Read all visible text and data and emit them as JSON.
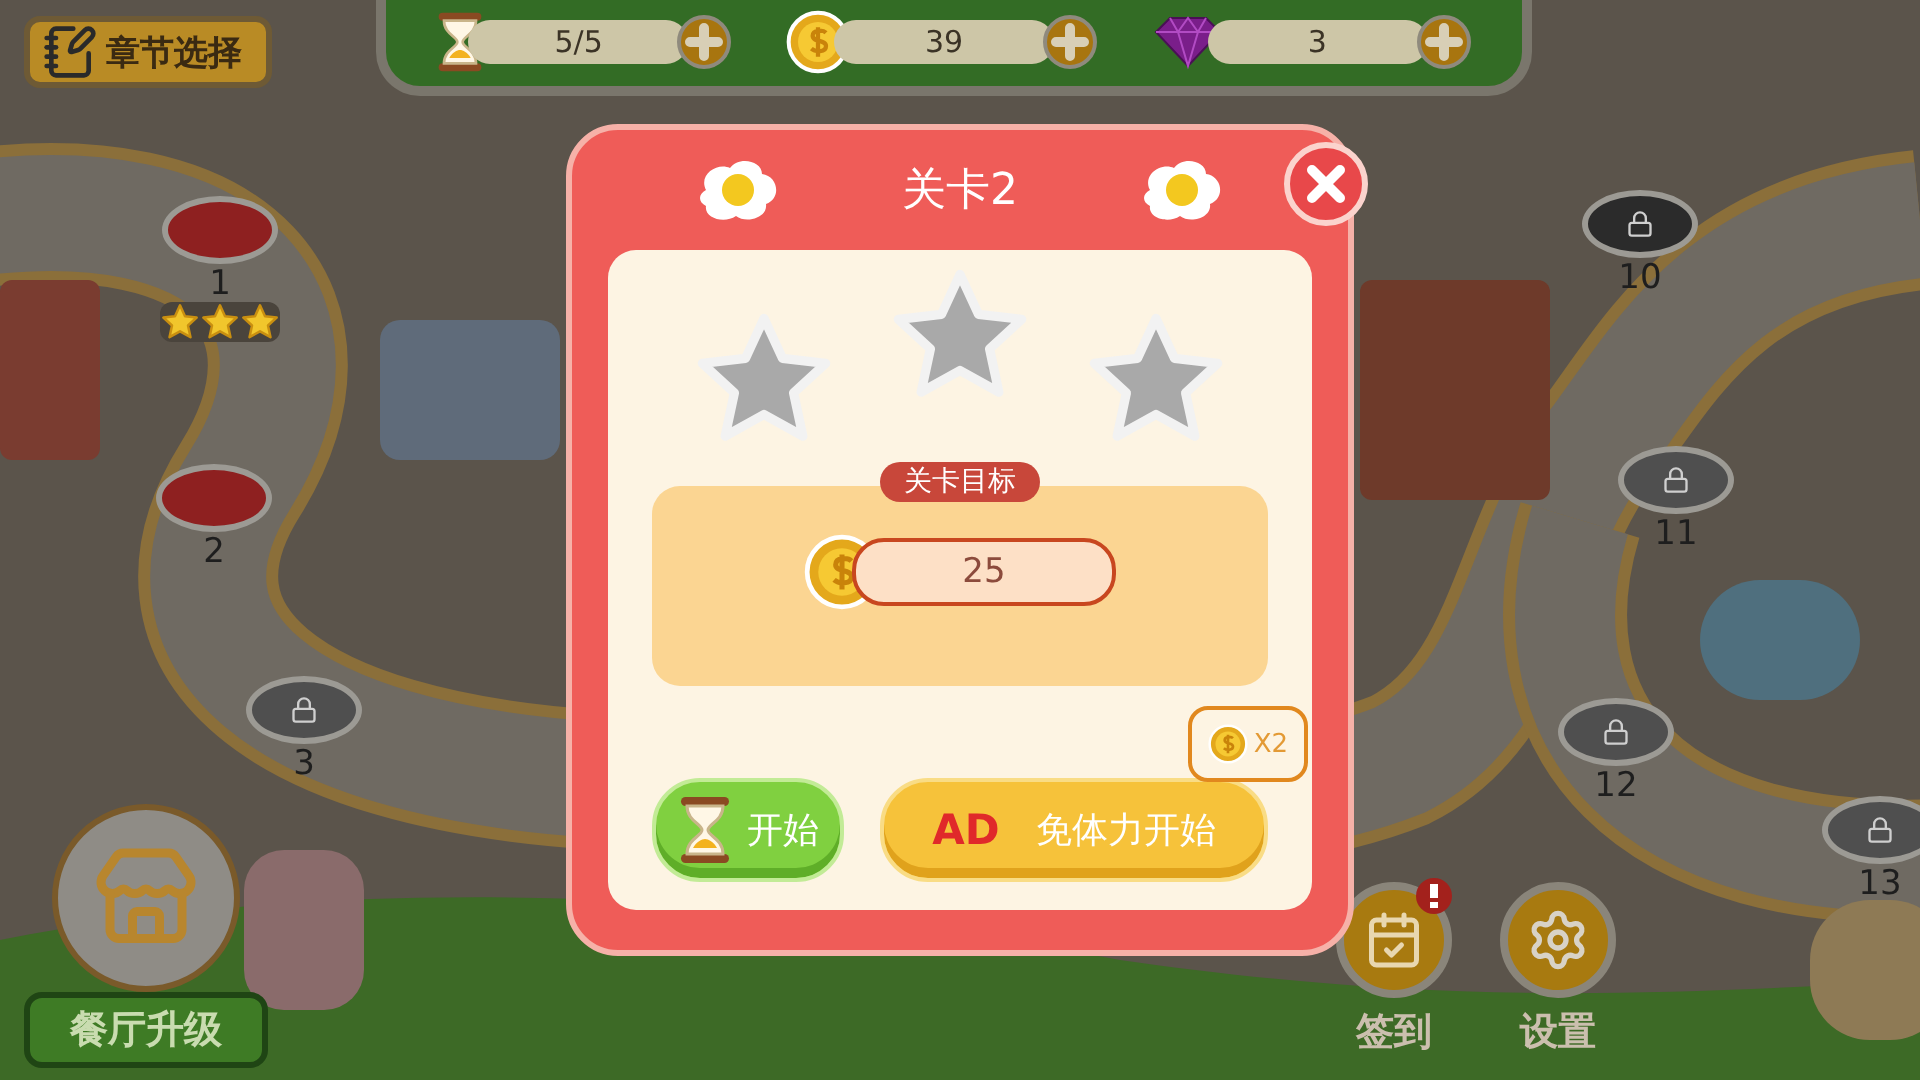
{
  "top_bar": {
    "chapter_button": "章节选择",
    "resources": [
      {
        "kind": "energy",
        "value": "5/5"
      },
      {
        "kind": "coin",
        "value": "39"
      },
      {
        "kind": "gem",
        "value": "3"
      }
    ]
  },
  "map": {
    "levels": [
      {
        "number": "1",
        "kind": "cleared",
        "stars": 3
      },
      {
        "number": "2",
        "kind": "current"
      },
      {
        "number": "3",
        "kind": "locked"
      },
      {
        "number": "10",
        "kind": "boss"
      },
      {
        "number": "11",
        "kind": "locked"
      },
      {
        "number": "12",
        "kind": "locked"
      },
      {
        "number": "13",
        "kind": "locked"
      }
    ]
  },
  "upgrade_button": "餐厅升级",
  "side_buttons": [
    {
      "kind": "checkin",
      "label": "签到",
      "alert": true
    },
    {
      "kind": "settings",
      "label": "设置",
      "alert": false
    }
  ],
  "dialog": {
    "title": "关卡2",
    "stars": 0,
    "goal_label": "关卡目标",
    "goal_value": "25",
    "buttons": [
      {
        "kind": "start",
        "label": "开始"
      },
      {
        "kind": "ad",
        "badge": "AD",
        "label": "免体力开始",
        "bonus": "X2"
      }
    ]
  }
}
